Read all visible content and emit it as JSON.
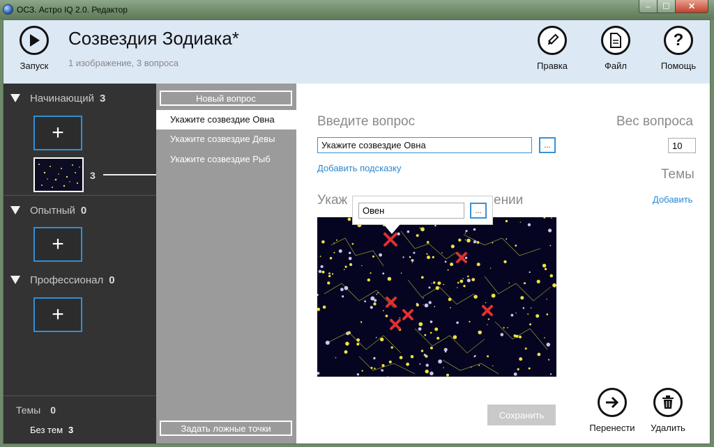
{
  "window": {
    "title": "ОСЗ. Астро IQ 2.0. Редактор",
    "minimize_glyph": "–",
    "maximize_glyph": "☐",
    "close_glyph": "✕"
  },
  "header": {
    "run_label": "Запуск",
    "title": "Созвездия Зодиака*",
    "subtitle": "1 изображение, 3 вопроса",
    "edit_label": "Правка",
    "file_label": "Файл",
    "help_label": "Помощь",
    "help_glyph": "?"
  },
  "sidebar": {
    "levels": [
      {
        "name": "Начинающий",
        "count": "3"
      },
      {
        "name": "Опытный",
        "count": "0"
      },
      {
        "name": "Профессионал",
        "count": "0"
      }
    ],
    "add_glyph": "+",
    "image_question_count": "3",
    "topics_label": "Темы",
    "topics_count": "0",
    "no_topics_label": "Без тем",
    "no_topics_count": "3"
  },
  "questions": {
    "new_button": "Новый вопрос",
    "items": [
      "Укажите созвездие Овна",
      "Укажите созвездие Девы",
      "Укажите созвездие Рыб"
    ],
    "active_index": 0,
    "false_points_button": "Задать ложные точки"
  },
  "editor": {
    "question_heading": "Введите вопрос",
    "question_value": "Укажите созвездие Овна",
    "dots_label": "...",
    "add_hint_link": "Добавить подсказку",
    "weight_heading": "Вес вопроса",
    "weight_value": "10",
    "topics_heading": "Темы",
    "add_topic_link": "Добавить",
    "image_heading_left": "Укаж",
    "image_heading_right": "ении",
    "popup_value": "Овен",
    "save_button": "Сохранить",
    "move_label": "Перенести",
    "delete_label": "Удалить",
    "marker_color": "#e0302f",
    "star_color": "#f0e040"
  }
}
